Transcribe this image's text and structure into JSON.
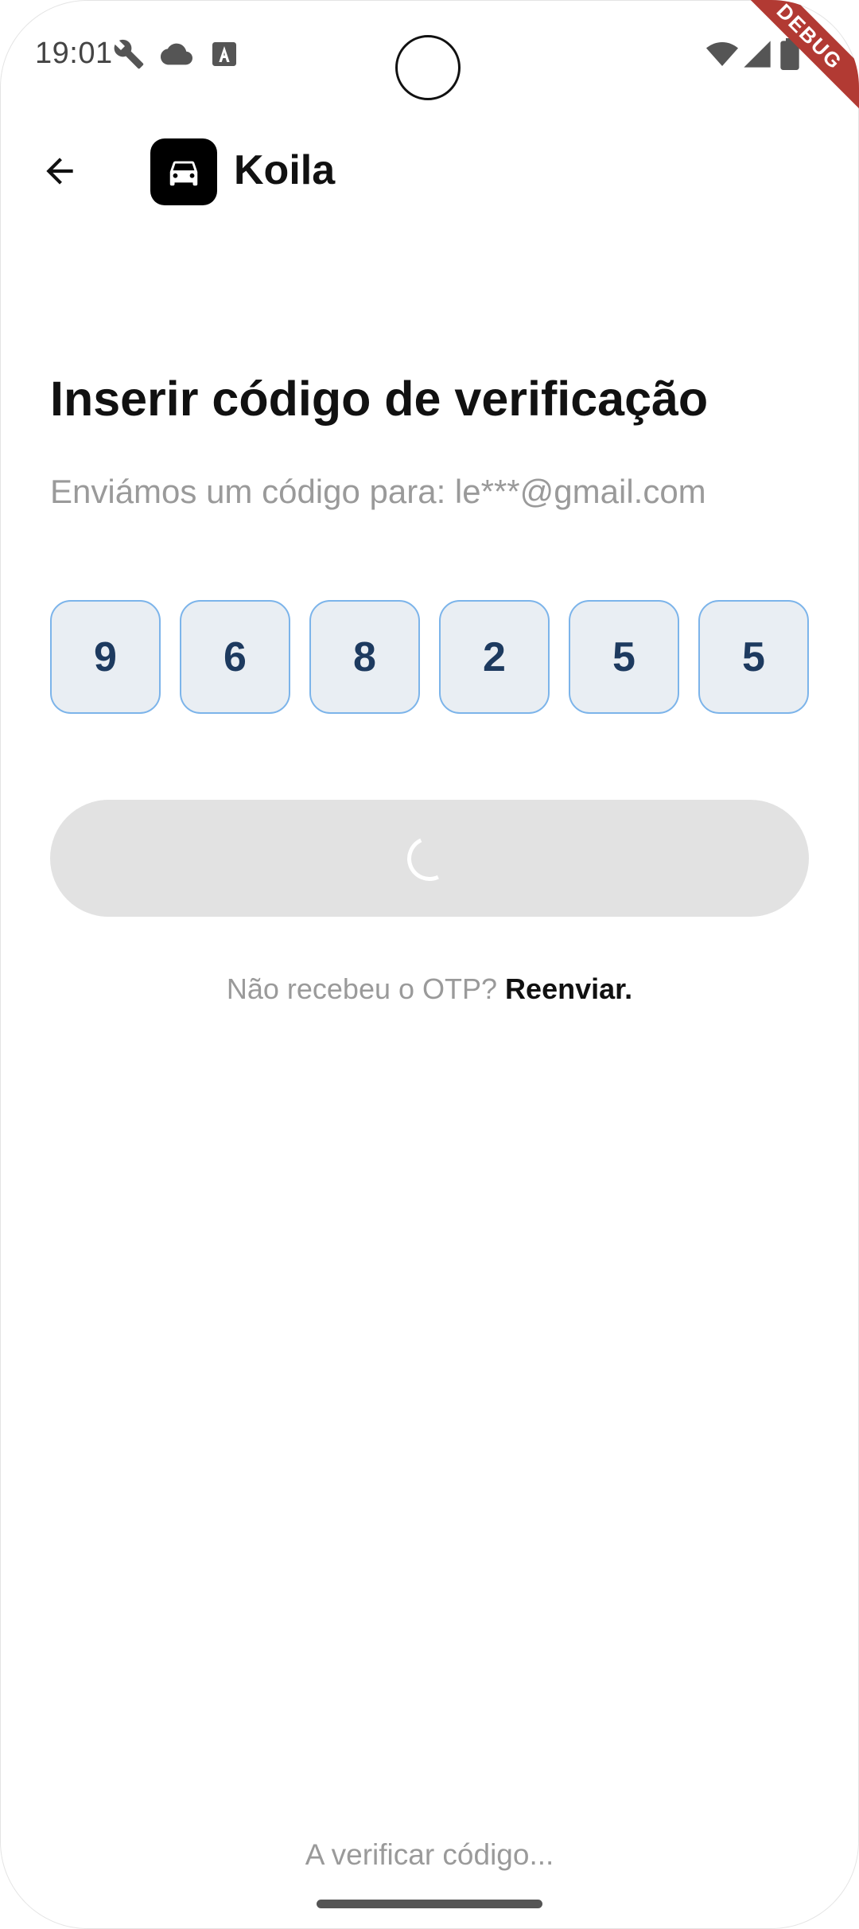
{
  "status_bar": {
    "time": "19:01",
    "icons_left": [
      "wrench-icon",
      "cloud-icon",
      "font-a-icon"
    ],
    "icons_right": [
      "wifi-icon",
      "signal-icon",
      "battery-icon"
    ]
  },
  "debug_ribbon": "DEBUG",
  "app_bar": {
    "back_icon": "arrow-left-icon",
    "logo_icon": "car-icon",
    "app_name": "Koila"
  },
  "main": {
    "title": "Inserir código de verificação",
    "subtitle": "Enviámos um código para: le***@gmail.com",
    "otp_digits": [
      "9",
      "6",
      "8",
      "2",
      "5",
      "5"
    ],
    "verify_button_state": "loading",
    "resend_prompt": "Não recebeu o OTP? ",
    "resend_link": "Reenviar."
  },
  "footer": {
    "status": "A verificar código..."
  },
  "colors": {
    "otp_border": "#7cb4ea",
    "otp_fill": "#e9eef3",
    "otp_text": "#1d3a5f",
    "button_disabled": "#e2e2e2",
    "debug_ribbon": "#b23a33"
  }
}
